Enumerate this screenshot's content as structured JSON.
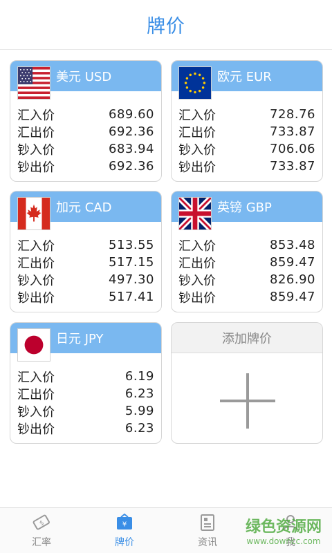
{
  "header": {
    "title": "牌价"
  },
  "row_labels": [
    "汇入价",
    "汇出价",
    "钞入价",
    "钞出价"
  ],
  "cards": [
    {
      "name": "美元 USD",
      "flag": "us-flag-icon",
      "values": [
        "689.60",
        "692.36",
        "683.94",
        "692.36"
      ]
    },
    {
      "name": "欧元 EUR",
      "flag": "eu-flag-icon",
      "values": [
        "728.76",
        "733.87",
        "706.06",
        "733.87"
      ]
    },
    {
      "name": "加元 CAD",
      "flag": "canada-flag-icon",
      "values": [
        "513.55",
        "517.15",
        "497.30",
        "517.41"
      ]
    },
    {
      "name": "英镑 GBP",
      "flag": "uk-flag-icon",
      "values": [
        "853.48",
        "859.47",
        "826.90",
        "859.47"
      ]
    },
    {
      "name": "日元 JPY",
      "flag": "japan-flag-icon",
      "values": [
        "6.19",
        "6.23",
        "5.99",
        "6.23"
      ]
    }
  ],
  "add_card": {
    "label": "添加牌价"
  },
  "tabs": [
    {
      "label": "汇率",
      "icon": "exchange-rate-icon"
    },
    {
      "label": "牌价",
      "icon": "price-board-icon"
    },
    {
      "label": "资讯",
      "icon": "news-icon"
    },
    {
      "label": "我",
      "icon": "user-icon"
    }
  ],
  "colors": {
    "accent": "#3a8ee6",
    "card_header": "#7ab8f0"
  },
  "watermark": {
    "cn": "绿色资源网",
    "en": "www.downcc.com"
  }
}
